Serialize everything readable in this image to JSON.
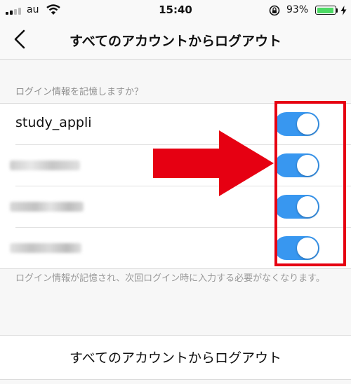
{
  "status_bar": {
    "carrier": "au",
    "time": "15:40",
    "battery_percent": "93%",
    "battery_level": 0.93
  },
  "nav": {
    "title": "すべてのアカウントからログアウト",
    "back_icon": "chevron-left-icon"
  },
  "section": {
    "header": "ログイン情報を記憶しますか？"
  },
  "accounts": [
    {
      "username": "study_appli",
      "remember": true
    },
    {
      "username": null,
      "remember": true
    },
    {
      "username": null,
      "remember": true
    },
    {
      "username": null,
      "remember": true
    }
  ],
  "footnote": "ログイン情報が記憶され、次回ログイン時に入力する必要がなくなります。",
  "logout_button": "すべてのアカウントからログアウト",
  "colors": {
    "toggle_on": "#3897f0",
    "annotation_red": "#e60012",
    "battery_green": "#4cd964"
  }
}
